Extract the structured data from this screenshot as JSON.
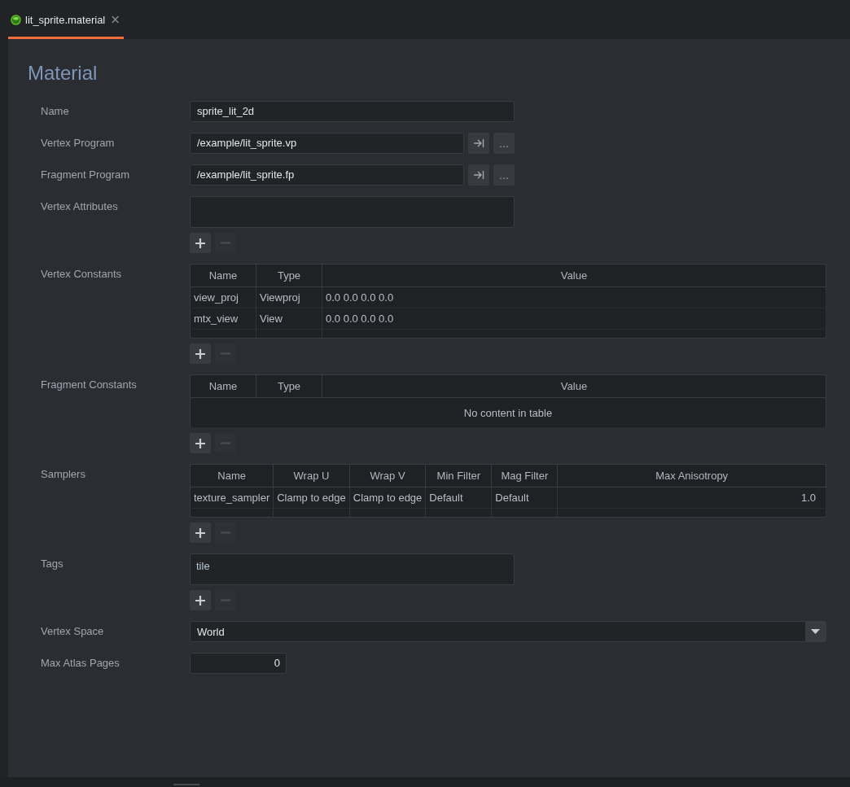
{
  "tabs": [
    {
      "label": "lit_sprite.material",
      "selected": true,
      "close": "×"
    }
  ],
  "title": "Material",
  "properties": [
    {
      "kind": "text",
      "label": "Name",
      "value": "sprite_lit_2d"
    },
    {
      "kind": "resource",
      "label": "Vertex Program",
      "value": "/example/lit_sprite.vp",
      "browse": "…"
    },
    {
      "kind": "resource",
      "label": "Fragment Program",
      "value": "/example/lit_sprite.fp",
      "browse": "…"
    },
    {
      "kind": "list",
      "label": "Vertex Attributes",
      "add_disabled": false,
      "remove_disabled": true
    },
    {
      "kind": "table",
      "label": "Vertex Constants",
      "columns": [
        {
          "label": "Name",
          "kind": "text"
        },
        {
          "label": "Type",
          "kind": "text"
        },
        {
          "label": "Value",
          "kind": "text"
        }
      ],
      "rows": [
        [
          "view_proj",
          "Viewproj",
          "0.0 0.0 0.0 0.0"
        ],
        [
          "mtx_view",
          "View",
          "0.0 0.0 0.0 0.0"
        ]
      ],
      "add_disabled": false,
      "remove_disabled": true
    },
    {
      "kind": "table",
      "label": "Fragment Constants",
      "columns": [
        {
          "label": "Name"
        },
        {
          "label": "Type"
        },
        {
          "label": "Value"
        }
      ],
      "empty_text": "No content in table",
      "add_disabled": false,
      "remove_disabled": true
    },
    {
      "kind": "table",
      "label": "Samplers",
      "columns": [
        {
          "label": "Name",
          "kind": "text"
        },
        {
          "label": "Wrap U",
          "kind": "text"
        },
        {
          "label": "Wrap V",
          "kind": "text"
        },
        {
          "label": "Min Filter",
          "kind": "text"
        },
        {
          "label": "Mag Filter",
          "kind": "text"
        },
        {
          "label": "Max Anisotropy",
          "kind": "number"
        }
      ],
      "rows": [
        [
          "texture_sampler",
          "Clamp to edge",
          "Clamp to edge",
          "Default",
          "Default",
          "1.0"
        ]
      ],
      "add_disabled": false,
      "remove_disabled": true
    },
    {
      "kind": "list",
      "label": "Tags",
      "items": [
        "tile"
      ],
      "add_disabled": false,
      "remove_disabled": true
    },
    {
      "kind": "select",
      "label": "Vertex Space",
      "value": "World"
    },
    {
      "kind": "number",
      "label": "Max Atlas Pages",
      "value": "0"
    }
  ]
}
